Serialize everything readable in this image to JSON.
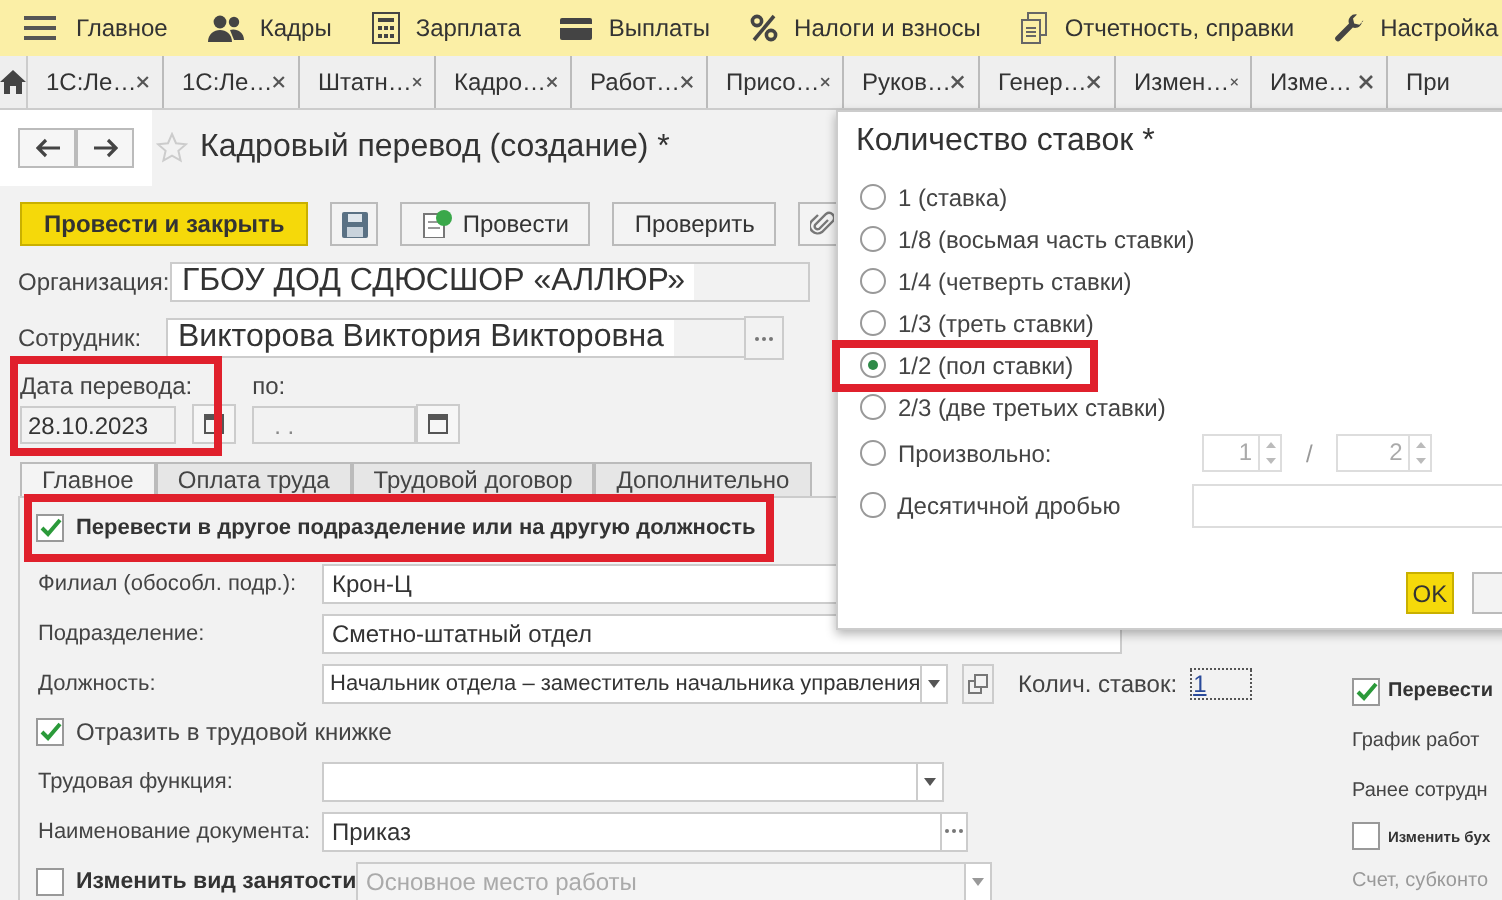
{
  "menu": [
    {
      "label": "Главное"
    },
    {
      "label": "Кадры"
    },
    {
      "label": "Зарплата"
    },
    {
      "label": "Выплаты"
    },
    {
      "label": "Налоги и взносы"
    },
    {
      "label": "Отчетность, справки"
    },
    {
      "label": "Настройка"
    }
  ],
  "open_tabs": [
    {
      "label": "1С:Ле…",
      "selected": false
    },
    {
      "label": "1С:Ле…",
      "selected": false
    },
    {
      "label": "Штатн…",
      "selected": false
    },
    {
      "label": "Кадро…",
      "selected": false
    },
    {
      "label": "Работ…",
      "selected": false
    },
    {
      "label": "Присо…",
      "selected": false
    },
    {
      "label": "Руков…",
      "selected": false
    },
    {
      "label": "Генер…",
      "selected": false
    },
    {
      "label": "Измен…",
      "selected": false
    },
    {
      "label": "Изме…",
      "selected": false
    },
    {
      "label": "При",
      "selected": false
    }
  ],
  "document": {
    "title": "Кадровый перевод (создание) *"
  },
  "toolbar": {
    "post_close": "Провести и закрыть",
    "post": "Провести",
    "check": "Проверить"
  },
  "organization": {
    "label": "Организация:",
    "value": "ГБОУ ДОД СДЮСШОР «АЛЛЮР»"
  },
  "employee": {
    "label": "Сотрудник:",
    "value": "Викторова Виктория Викторовна"
  },
  "date": {
    "label": "Дата перевода:",
    "value": "28.10.2023"
  },
  "date_to": {
    "label": "по:",
    "placeholder": ". ."
  },
  "form_tabs": [
    {
      "label": "Главное",
      "selected": true
    },
    {
      "label": "Оплата труда",
      "selected": false
    },
    {
      "label": "Трудовой договор",
      "selected": false
    },
    {
      "label": "Дополнительно",
      "selected": false
    }
  ],
  "transfer_checkbox": {
    "label": "Перевести в другое подразделение или на другую должность",
    "checked": true
  },
  "branch": {
    "label": "Филиал (обособл. подр.):",
    "value": "Крон-Ц"
  },
  "department": {
    "label": "Подразделение:",
    "value": "Сметно-штатный отдел"
  },
  "position": {
    "label": "Должность:",
    "value": "Начальник отдела – заместитель начальника управления"
  },
  "rate": {
    "label": "Колич. ставок:",
    "value": "1"
  },
  "book_checkbox": {
    "label": "Отразить в трудовой книжке",
    "checked": true
  },
  "labor_function": {
    "label": "Трудовая функция:"
  },
  "document_name": {
    "label": "Наименование документа:",
    "value": "Приказ"
  },
  "employment_change": {
    "label": "Изменить вид занятости",
    "checked": false,
    "value": "Основное место работы",
    "disabled": true
  },
  "right_panel": {
    "transfer": {
      "label": "Перевести",
      "checked": true
    },
    "schedule_label": "График работ",
    "earlier_label": "Ранее сотрудн",
    "accounting": {
      "label": "Изменить бух",
      "checked": false
    },
    "account_label": "Счет, субконто"
  },
  "popup": {
    "title": "Количество ставок *",
    "options": [
      {
        "label": "1 (ставка)",
        "selected": false,
        "kind": "plain"
      },
      {
        "label": "1/8 (восьмая часть ставки)",
        "selected": false,
        "kind": "plain"
      },
      {
        "label": "1/4 (четверть ставки)",
        "selected": false,
        "kind": "plain"
      },
      {
        "label": "1/3 (треть ставки)",
        "selected": false,
        "kind": "plain"
      },
      {
        "label": "1/2 (пол ставки)",
        "selected": true,
        "kind": "plain"
      },
      {
        "label": "2/3 (две третьих ставки)",
        "selected": false,
        "kind": "plain"
      },
      {
        "label": "Произвольно:",
        "selected": false,
        "kind": "fraction"
      },
      {
        "label": "Десятичной дробью",
        "selected": false,
        "kind": "decimal"
      }
    ],
    "numerator": "1",
    "separator": "/",
    "denominator": "2",
    "ok": "OK"
  }
}
